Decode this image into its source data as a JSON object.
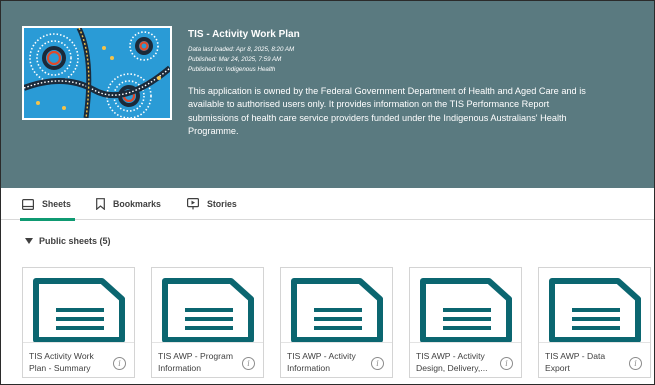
{
  "app": {
    "title": "TIS - Activity Work Plan",
    "last_loaded": "Data last loaded: Apr 8, 2025, 8:20 AM",
    "published": "Published: Mar 24, 2025, 7:59 AM",
    "published_to": "Published to: Indigenous Health",
    "description": "This application is owned by the Federal Government Department of Health and Aged Care and is available to authorised users only. It provides information on the TIS Performance Report submissions of health care service providers funded under the Indigenous Australians' Health Programme."
  },
  "tabs": [
    {
      "label": "Sheets",
      "icon": "sheet-icon",
      "active": true
    },
    {
      "label": "Bookmarks",
      "icon": "bookmark-icon",
      "active": false
    },
    {
      "label": "Stories",
      "icon": "story-icon",
      "active": false
    }
  ],
  "section": {
    "label": "Public sheets (5)"
  },
  "sheets": [
    {
      "title": "TIS Activity Work Plan - Summary"
    },
    {
      "title": "TIS AWP - Program Information"
    },
    {
      "title": "TIS AWP - Activity Information"
    },
    {
      "title": "TIS AWP - Activity Design, Delivery,..."
    },
    {
      "title": "TIS AWP - Data Export"
    }
  ],
  "colors": {
    "header_bg": "#5a7a80",
    "accent": "#0f9a72",
    "sheet_icon": "#0b6670"
  }
}
